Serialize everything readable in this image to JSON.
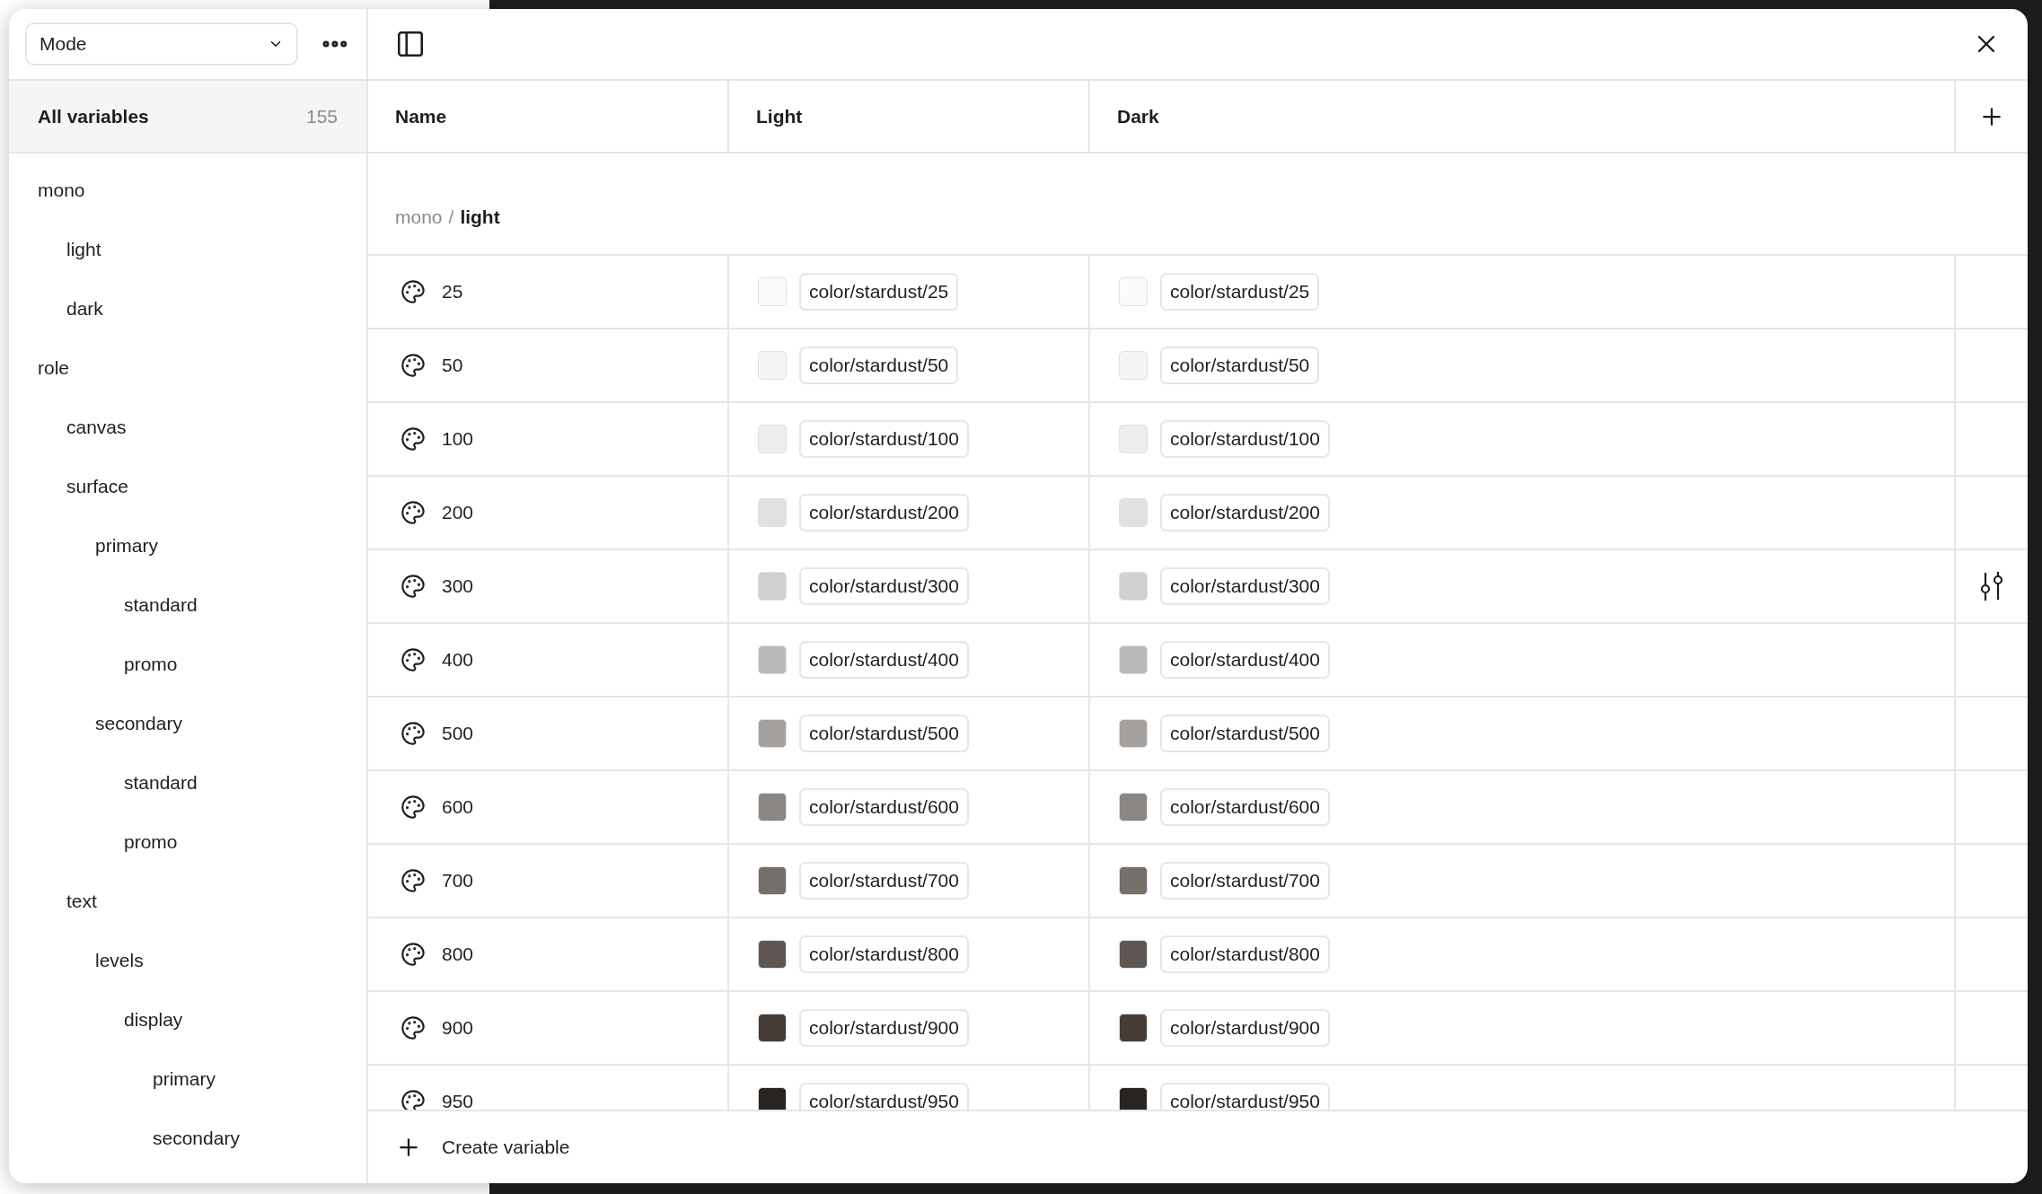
{
  "toolbar": {
    "mode_dropdown": "Mode"
  },
  "sidebar": {
    "all_variables": {
      "label": "All variables",
      "count": "155"
    },
    "groups": [
      {
        "label": "mono",
        "children": [
          {
            "label": "light"
          },
          {
            "label": "dark"
          }
        ]
      },
      {
        "label": "role",
        "children": [
          {
            "label": "canvas"
          },
          {
            "label": "surface",
            "children": [
              {
                "label": "primary",
                "children": [
                  {
                    "label": "standard"
                  },
                  {
                    "label": "promo"
                  }
                ]
              },
              {
                "label": "secondary",
                "children": [
                  {
                    "label": "standard"
                  },
                  {
                    "label": "promo"
                  }
                ]
              }
            ]
          },
          {
            "label": "text",
            "children": [
              {
                "label": "levels",
                "children": [
                  {
                    "label": "display",
                    "children": [
                      {
                        "label": "primary"
                      },
                      {
                        "label": "secondary"
                      }
                    ]
                  }
                ]
              }
            ]
          }
        ]
      }
    ]
  },
  "table": {
    "columns": [
      "Name",
      "Light",
      "Dark"
    ],
    "group_path": {
      "parent": "mono",
      "separator": "/",
      "current": "light"
    },
    "rows": [
      {
        "name": "25",
        "hovered": false,
        "light": {
          "value": "color/stardust/25",
          "color": "#fafaf9"
        },
        "dark": {
          "value": "color/stardust/25",
          "color": "#fafaf9"
        }
      },
      {
        "name": "50",
        "hovered": false,
        "light": {
          "value": "color/stardust/50",
          "color": "#f6f5f4"
        },
        "dark": {
          "value": "color/stardust/50",
          "color": "#f6f5f4"
        }
      },
      {
        "name": "100",
        "hovered": false,
        "light": {
          "value": "color/stardust/100",
          "color": "#eeedeb"
        },
        "dark": {
          "value": "color/stardust/100",
          "color": "#eeedeb"
        }
      },
      {
        "name": "200",
        "hovered": false,
        "light": {
          "value": "color/stardust/200",
          "color": "#e2e1df"
        },
        "dark": {
          "value": "color/stardust/200",
          "color": "#e2e1df"
        }
      },
      {
        "name": "300",
        "hovered": true,
        "light": {
          "value": "color/stardust/300",
          "color": "#d2d1cf"
        },
        "dark": {
          "value": "color/stardust/300",
          "color": "#d2d1cf"
        }
      },
      {
        "name": "400",
        "hovered": false,
        "light": {
          "value": "color/stardust/400",
          "color": "#bbbab8"
        },
        "dark": {
          "value": "color/stardust/400",
          "color": "#bbbab8"
        }
      },
      {
        "name": "500",
        "hovered": false,
        "light": {
          "value": "color/stardust/500",
          "color": "#a5a19e"
        },
        "dark": {
          "value": "color/stardust/500",
          "color": "#a5a19e"
        }
      },
      {
        "name": "600",
        "hovered": false,
        "light": {
          "value": "color/stardust/600",
          "color": "#8b8683"
        },
        "dark": {
          "value": "color/stardust/600",
          "color": "#8b8683"
        }
      },
      {
        "name": "700",
        "hovered": false,
        "light": {
          "value": "color/stardust/700",
          "color": "#756f6a"
        },
        "dark": {
          "value": "color/stardust/700",
          "color": "#756f6a"
        }
      },
      {
        "name": "800",
        "hovered": false,
        "light": {
          "value": "color/stardust/800",
          "color": "#5e5652"
        },
        "dark": {
          "value": "color/stardust/800",
          "color": "#5e5652"
        }
      },
      {
        "name": "900",
        "hovered": false,
        "light": {
          "value": "color/stardust/900",
          "color": "#453c35"
        },
        "dark": {
          "value": "color/stardust/900",
          "color": "#453c35"
        }
      },
      {
        "name": "950",
        "hovered": false,
        "light": {
          "value": "color/stardust/950",
          "color": "#2a2420"
        },
        "dark": {
          "value": "color/stardust/950",
          "color": "#2a2420"
        }
      }
    ]
  },
  "footer": {
    "create_button": "Create variable"
  }
}
